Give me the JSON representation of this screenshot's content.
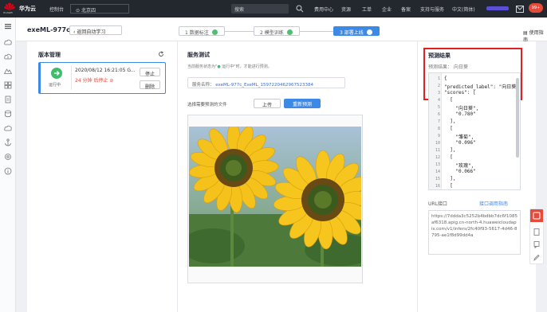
{
  "topbar": {
    "logo_text": "HUAWEI",
    "brand": "华为云",
    "console": "控制台",
    "region": "北京四",
    "search_placeholder": "搜索",
    "nav": [
      "费用中心",
      "资源",
      "工单",
      "企业",
      "备案",
      "支持与服务",
      "中文(简体)"
    ],
    "badge": "99+"
  },
  "subheader": {
    "title": "exeML-977c",
    "back_label": "返回自动学习",
    "steps": [
      {
        "label": "1 数据标注"
      },
      {
        "label": "2 模型训练"
      },
      {
        "label": "3 部署上线"
      }
    ],
    "guide_label": "使用指南"
  },
  "version_panel": {
    "title": "版本管理",
    "card": {
      "status": "运行中",
      "time": "2020/08/12 16:21:05 G...",
      "stop_info": "24 分钟 后停止",
      "stop_button": "停止",
      "delete_button": "删除"
    }
  },
  "service_test": {
    "title": "服务测试",
    "status_prefix": "当前服务状态为\"",
    "status_value": "运行中",
    "status_suffix": "\"时，才能进行预测。",
    "name_label": "服务名称：",
    "name_value": "exeML-977c_ExeML_1597220462967523384",
    "upload_label": "选择需要预测的文件",
    "upload_button": "上传",
    "predict_button": "重新预测"
  },
  "prediction": {
    "title": "预测结果",
    "result_label": "预测结果：",
    "result_value": "向日葵",
    "code_lines": [
      {
        "n": "1",
        "t": "{"
      },
      {
        "n": "2",
        "t": "\"predicted_label\": \"向日葵"
      },
      {
        "n": "3",
        "t": "\"scores\": ["
      },
      {
        "n": "4",
        "t": "  ["
      },
      {
        "n": "5",
        "t": "    \"向日葵\","
      },
      {
        "n": "6",
        "t": "    \"0.780\""
      },
      {
        "n": "7",
        "t": "  ],"
      },
      {
        "n": "8",
        "t": "  ["
      },
      {
        "n": "9",
        "t": "    \"雏菊\","
      },
      {
        "n": "10",
        "t": "    \"0.096\""
      },
      {
        "n": "11",
        "t": "  ],"
      },
      {
        "n": "12",
        "t": "  ["
      },
      {
        "n": "13",
        "t": "    \"玫瑰\","
      },
      {
        "n": "14",
        "t": "    \"0.066\""
      },
      {
        "n": "15",
        "t": "  ],"
      },
      {
        "n": "16",
        "t": "  ["
      }
    ]
  },
  "url": {
    "label": "URL接口",
    "link": "接口调用指南",
    "value": "https://7ddda3c5252b4bdbb7dc6f1085af6318.apig.cn-north-4.huaweicloudapis.com/v1/infers/2fc40f93-5617-4d46-8795-ae1f8d99dd4a"
  }
}
